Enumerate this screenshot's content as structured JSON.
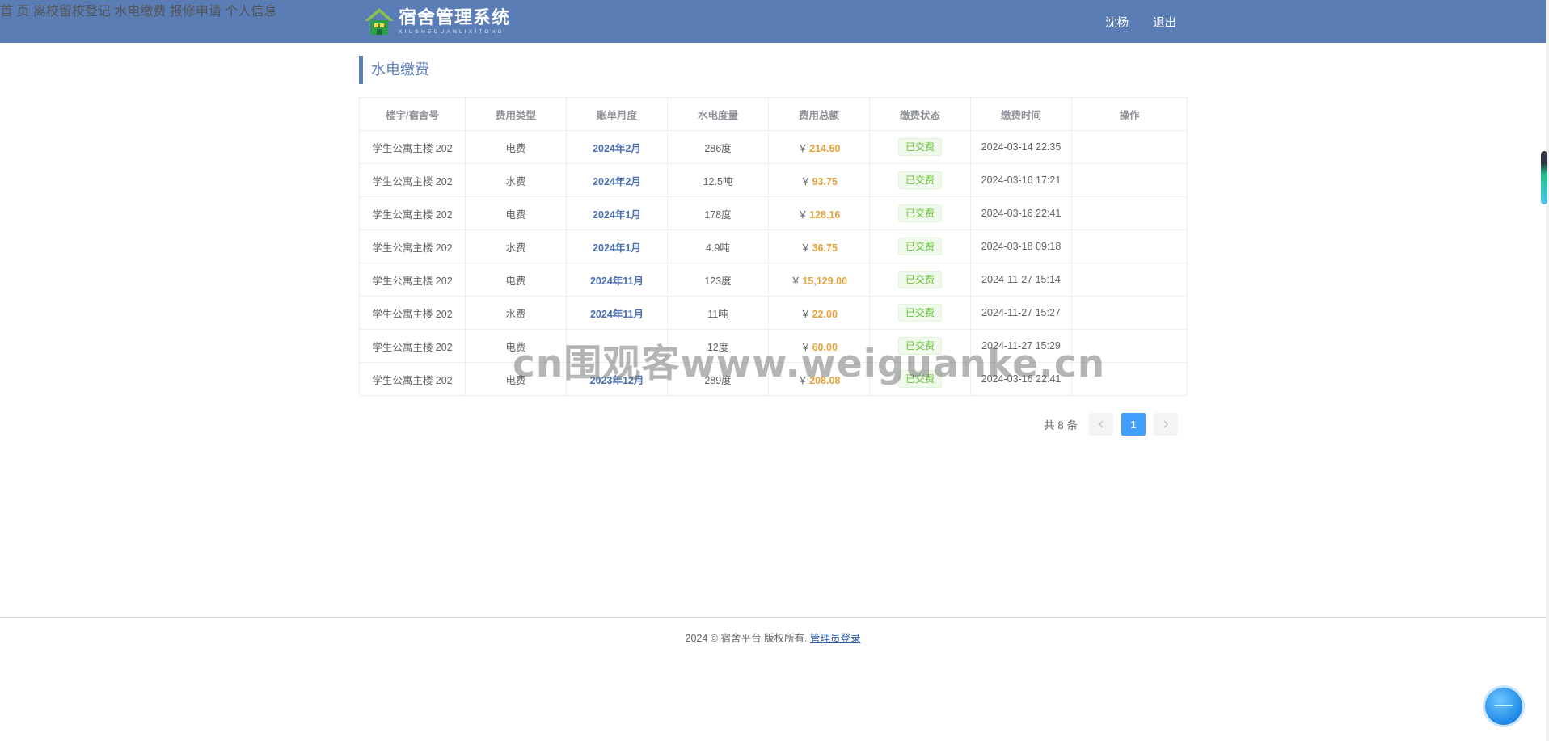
{
  "header": {
    "brand_title": "宿舍管理系统",
    "brand_subtitle": "XIUSHEGUANLIXITONG",
    "nav": [
      {
        "label": "首 页"
      },
      {
        "label": "离校留校登记"
      },
      {
        "label": "水电缴费"
      },
      {
        "label": "报修申请"
      },
      {
        "label": "个人信息"
      }
    ],
    "username": "沈杨",
    "logout_label": "退出",
    "colors": {
      "bar": "#5b7db6"
    }
  },
  "section_title": "水电缴费",
  "table": {
    "headers": [
      "楼宇/宿舍号",
      "费用类型",
      "账单月度",
      "水电度量",
      "费用总额",
      "缴费状态",
      "缴费时间",
      "操作"
    ],
    "currency_symbol": "￥",
    "rows": [
      {
        "dorm": "学生公寓主楼 202",
        "type": "电费",
        "month": "2024年2月",
        "usage": "286度",
        "amount": "214.50",
        "status": "已交费",
        "time": "2024-03-14 22:35",
        "action": ""
      },
      {
        "dorm": "学生公寓主楼 202",
        "type": "水费",
        "month": "2024年2月",
        "usage": "12.5吨",
        "amount": "93.75",
        "status": "已交费",
        "time": "2024-03-16 17:21",
        "action": ""
      },
      {
        "dorm": "学生公寓主楼 202",
        "type": "电费",
        "month": "2024年1月",
        "usage": "178度",
        "amount": "128.16",
        "status": "已交费",
        "time": "2024-03-16 22:41",
        "action": ""
      },
      {
        "dorm": "学生公寓主楼 202",
        "type": "水费",
        "month": "2024年1月",
        "usage": "4.9吨",
        "amount": "36.75",
        "status": "已交费",
        "time": "2024-03-18 09:18",
        "action": ""
      },
      {
        "dorm": "学生公寓主楼 202",
        "type": "电费",
        "month": "2024年11月",
        "usage": "123度",
        "amount": "15,129.00",
        "status": "已交费",
        "time": "2024-11-27 15:14",
        "action": ""
      },
      {
        "dorm": "学生公寓主楼 202",
        "type": "水费",
        "month": "2024年11月",
        "usage": "11吨",
        "amount": "22.00",
        "status": "已交费",
        "time": "2024-11-27 15:27",
        "action": ""
      },
      {
        "dorm": "学生公寓主楼 202",
        "type": "电费",
        "month": "",
        "usage": "12度",
        "amount": "60.00",
        "status": "已交费",
        "time": "2024-11-27 15:29",
        "action": ""
      },
      {
        "dorm": "学生公寓主楼 202",
        "type": "电费",
        "month": "2023年12月",
        "usage": "289度",
        "amount": "208.08",
        "status": "已交费",
        "time": "2024-03-16 22:41",
        "action": ""
      }
    ]
  },
  "pagination": {
    "total_text": "共 8 条",
    "prev_icon": "chevron-left-icon",
    "current_page": "1",
    "next_icon": "chevron-right-icon"
  },
  "watermark": "cn围观客www.weiguanke.cn",
  "footer": {
    "text": "2024 © 宿舍平台 版权所有.",
    "admin_link": "管理员登录"
  }
}
